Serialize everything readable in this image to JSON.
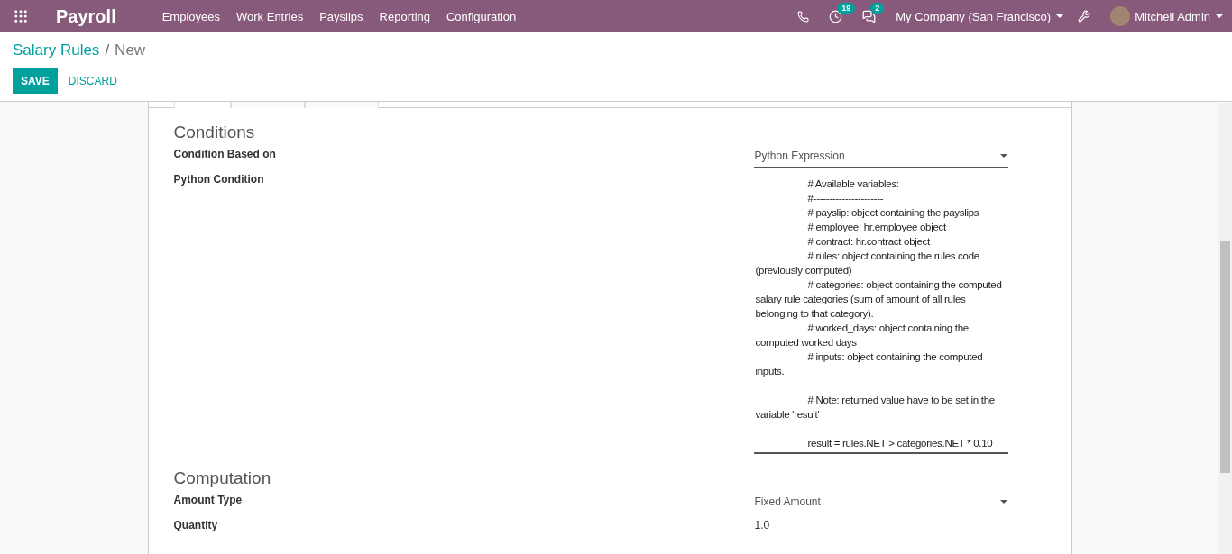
{
  "navbar": {
    "app_title": "Payroll",
    "menu": [
      "Employees",
      "Work Entries",
      "Payslips",
      "Reporting",
      "Configuration"
    ],
    "activity_count": "19",
    "message_count": "2",
    "company": "My Company (San Francisco)",
    "user": "Mitchell Admin"
  },
  "breadcrumb": {
    "parent": "Salary Rules",
    "separator": "/",
    "current": "New"
  },
  "buttons": {
    "save": "SAVE",
    "discard": "DISCARD"
  },
  "tabs": [
    {
      "selected": true
    },
    {
      "selected": false
    },
    {
      "selected": false
    }
  ],
  "sections": [
    {
      "title": "Conditions",
      "fields": [
        {
          "kind": "select",
          "label": "Condition Based on",
          "value": "Python Expression"
        },
        {
          "kind": "code",
          "label": "Python Condition",
          "blocks": [
            [
              "# Available variables:",
              "#----------------------",
              "# payslip: object containing the payslips",
              "# employee: hr.employee object",
              "# contract: hr.contract object",
              "# rules: object containing the rules code (previously computed)",
              "# categories: object containing the computed salary rule categories (sum of amount of all rules belonging to that category).",
              "# worked_days: object containing the computed worked days",
              "# inputs: object containing the computed inputs."
            ],
            [
              "# Note: returned value have to be set in the variable 'result'"
            ],
            [
              "result = rules.NET > categories.NET * 0.10"
            ]
          ]
        }
      ]
    },
    {
      "title": "Computation",
      "fields": [
        {
          "kind": "select",
          "label": "Amount Type",
          "value": "Fixed Amount"
        },
        {
          "kind": "text",
          "label": "Quantity",
          "value": "1.0"
        }
      ]
    }
  ]
}
